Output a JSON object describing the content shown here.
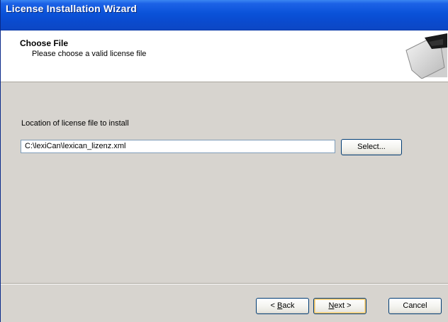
{
  "window": {
    "title": "License Installation Wizard"
  },
  "header": {
    "title": "Choose File",
    "subtitle": "Please choose a valid license file"
  },
  "content": {
    "location_label": "Location of license file to install",
    "path_value": "C:\\lexiCan\\lexican_lizenz.xml",
    "select_label": "Select..."
  },
  "footer": {
    "back_mnemonic": "B",
    "back_rest": "ack",
    "next_mnemonic": "N",
    "next_rest": "ext",
    "cancel_label": "Cancel"
  },
  "icons": {
    "header_graphic": "license-document-icon"
  },
  "colors": {
    "titlebar": "#0a52d9",
    "dialog_bg": "#d7d4cf",
    "header_bg": "#ffffff"
  }
}
